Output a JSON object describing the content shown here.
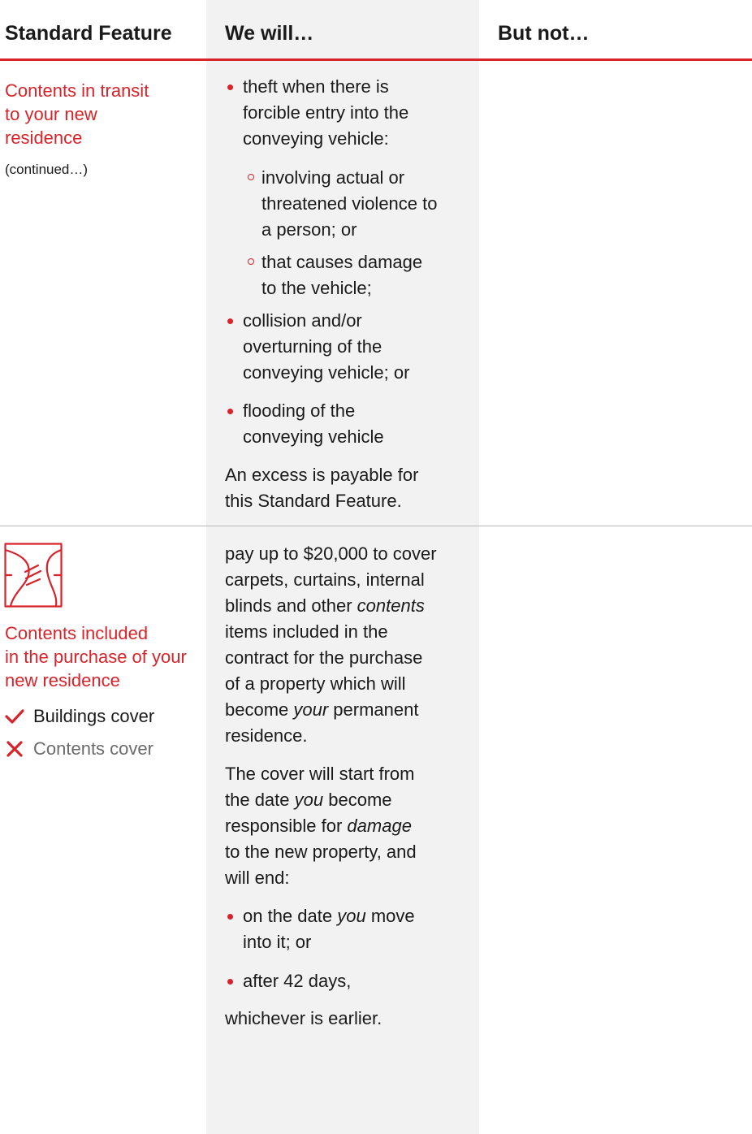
{
  "header": {
    "col1": "Standard Feature",
    "col2": "We will…",
    "col3": "But not…"
  },
  "row1": {
    "feature_lines": [
      "Contents in transit",
      "to your new",
      "residence"
    ],
    "continued": "(continued…)",
    "bullet1_lines": [
      "theft when there is",
      "forcible entry into the",
      "conveying vehicle:"
    ],
    "sub1_lines": [
      "involving actual or",
      "threatened violence to",
      "a person; or"
    ],
    "sub2_lines": [
      "that causes damage",
      "to the vehicle;"
    ],
    "bullet2_lines": [
      "collision and/or",
      "overturning of the",
      "conveying vehicle; or"
    ],
    "bullet3_lines": [
      "flooding of the",
      "conveying vehicle"
    ],
    "excess_lines": [
      "An excess is payable for",
      "this Standard Feature."
    ]
  },
  "row2": {
    "icon": "curtains-icon",
    "feature_lines": [
      "Contents included",
      "in the purchase of your",
      "new residence"
    ],
    "buildings_cover": "Buildings cover",
    "contents_cover": "Contents cover",
    "para1": {
      "l1": "pay up to $20,000 to cover",
      "l2": "carpets, curtains, internal",
      "l3a": "blinds and other ",
      "l3b": "contents",
      "l4": "items included in the",
      "l5": "contract for the purchase",
      "l6": "of a property which will",
      "l7a": "become ",
      "l7b": "your",
      "l7c": " permanent",
      "l8": "residence."
    },
    "para2": {
      "l1": "The cover will start from",
      "l2a": "the date ",
      "l2b": "you",
      "l2c": " become",
      "l3a": "responsible for ",
      "l3b": "damage",
      "l4": "to the new property, and",
      "l5": "will end:"
    },
    "bullet1": {
      "a": "on the date ",
      "b": "you",
      "c": " move",
      "l2": "into it; or"
    },
    "bullet2": "after 42 days,",
    "closing": "whichever is earlier."
  },
  "colors": {
    "accent_red": "#d8232a",
    "column_grey": "#f2f2f2",
    "divider": "#b8b8b8"
  }
}
